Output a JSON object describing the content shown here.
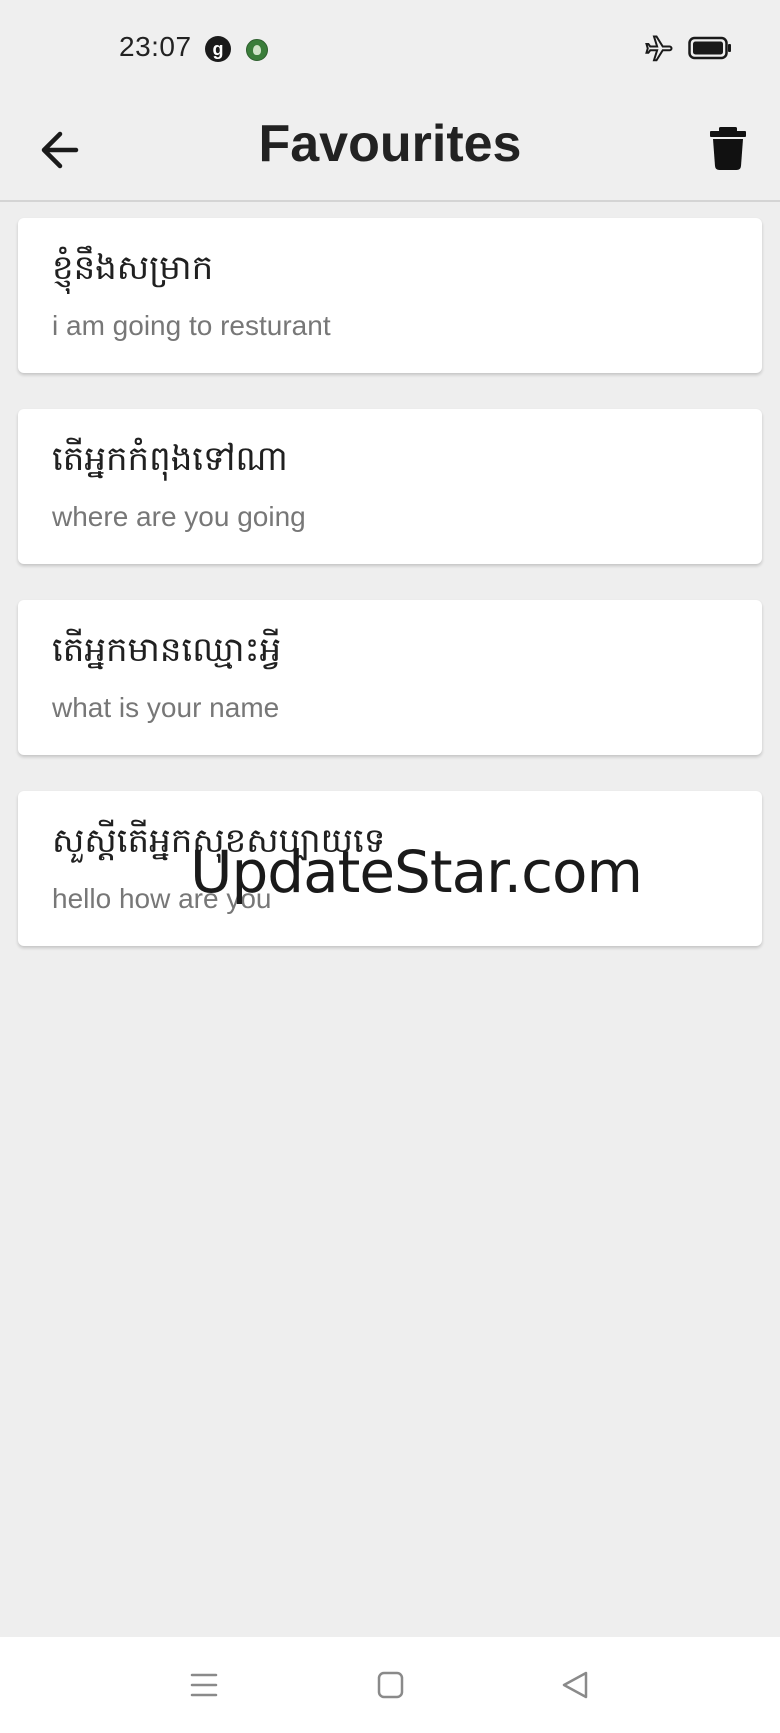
{
  "status_bar": {
    "time": "23:07",
    "notification_letter": "g",
    "icons": [
      "g-app-icon",
      "app-notification-icon",
      "airplane-mode-icon",
      "battery-icon"
    ]
  },
  "app_bar": {
    "title": "Favourites",
    "back_icon": "arrow-left-icon",
    "delete_icon": "trash-icon"
  },
  "favourites": [
    {
      "khmer": "ខ្ញុំនឹងសម្រាក",
      "english": "i am going to resturant"
    },
    {
      "khmer": "តើអ្នកកំពុងទៅណា",
      "english": "where are you going"
    },
    {
      "khmer": "តើអ្នកមានឈ្មោះអ្វី",
      "english": "what is your name"
    },
    {
      "khmer": "សួស្តីតើអ្នកសុខសប្បាយទេ",
      "english": "hello how are you"
    }
  ],
  "watermark": "UpdateStar.com",
  "nav_bar": {
    "icons": [
      "menu-icon",
      "home-square-icon",
      "back-triangle-icon"
    ]
  },
  "colors": {
    "background": "#eeeeee",
    "card": "#ffffff",
    "title_text": "#222222",
    "secondary_text": "#777777"
  }
}
